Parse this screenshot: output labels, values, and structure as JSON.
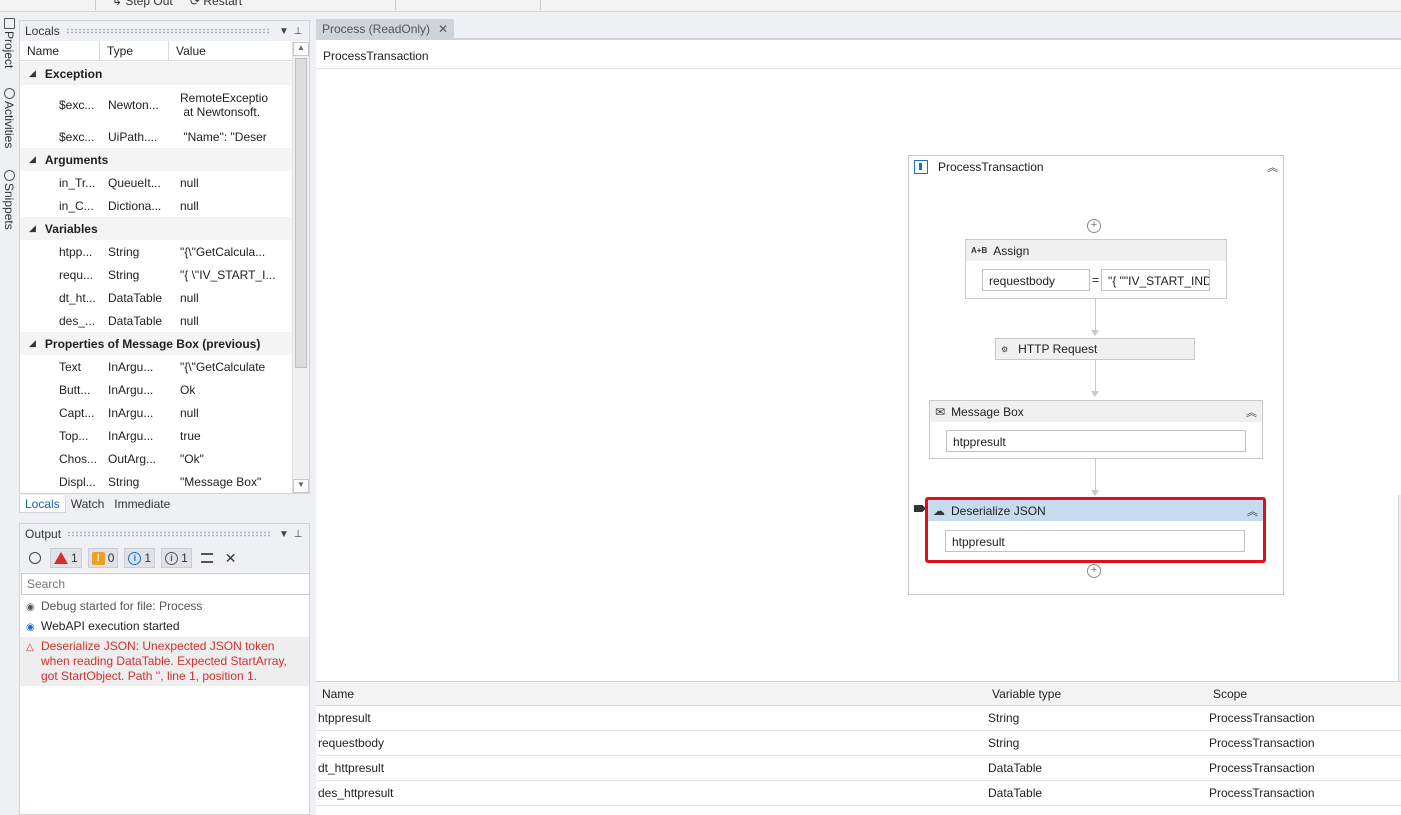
{
  "toolbar": {
    "step_out_label": "Step Out",
    "restart_label": "Restart"
  },
  "side_tabs": [
    "Project",
    "Activities",
    "Snippets"
  ],
  "locals": {
    "title": "Locals",
    "columns": [
      "Name",
      "Type",
      "Value"
    ],
    "groups": {
      "exception": "Exception",
      "arguments": "Arguments",
      "variables": "Variables",
      "properties": "Properties of Message Box (previous)"
    },
    "exception_rows": [
      {
        "name": "$exc...",
        "type": "Newton...",
        "value_line1": "RemoteExceptio",
        "value_line2": " at Newtonsoft."
      },
      {
        "name": "$exc...",
        "type": "UiPath....",
        "value": " \"Name\": \"Deser"
      }
    ],
    "argument_rows": [
      {
        "name": "in_Tr...",
        "type": "QueueIt...",
        "value": "null"
      },
      {
        "name": "in_C...",
        "type": "Dictiona...",
        "value": "null"
      }
    ],
    "variable_rows": [
      {
        "name": "htpp...",
        "type": "String",
        "value": "\"{\\\"GetCalcula..."
      },
      {
        "name": "requ...",
        "type": "String",
        "value": "\"{ \\\"IV_START_I..."
      },
      {
        "name": "dt_ht...",
        "type": "DataTable",
        "value": "null"
      },
      {
        "name": "des_...",
        "type": "DataTable",
        "value": "null"
      }
    ],
    "property_rows": [
      {
        "name": "Text",
        "type": "InArgu...",
        "value": "\"{\\\"GetCalculate"
      },
      {
        "name": "Butt...",
        "type": "InArgu...",
        "value": "Ok"
      },
      {
        "name": "Capt...",
        "type": "InArgu...",
        "value": "null"
      },
      {
        "name": "Top...",
        "type": "InArgu...",
        "value": "true"
      },
      {
        "name": "Chos...",
        "type": "OutArg...",
        "value": "\"Ok\""
      },
      {
        "name": "Displ...",
        "type": "String",
        "value": "\"Message Box\""
      }
    ]
  },
  "bottom_tabs": [
    "Locals",
    "Watch",
    "Immediate"
  ],
  "output": {
    "title": "Output",
    "error_count": "1",
    "warning_count": "0",
    "info_count": "1",
    "trace_count": "1",
    "search_placeholder": "Search",
    "lines": [
      {
        "kind": "trace",
        "text": "Debug started for file: Process"
      },
      {
        "kind": "info",
        "text": "WebAPI execution started"
      },
      {
        "kind": "error",
        "text": "Deserialize JSON: Unexpected JSON token when reading DataTable. Expected StartArray, got StartObject. Path '', line 1, position 1."
      }
    ]
  },
  "designer": {
    "tab_label": "Process (ReadOnly)",
    "breadcrumb": "ProcessTransaction",
    "sequence_title": "ProcessTransaction",
    "assign": {
      "title": "Assign",
      "icon_text": "A+B",
      "to": "requestbody",
      "equals": "=",
      "value": "\"{ \"\"IV_START_INDI"
    },
    "http_request": {
      "title": "HTTP Request"
    },
    "message_box": {
      "title": "Message Box",
      "text": "htppresult"
    },
    "deserialize_json": {
      "title": "Deserialize JSON",
      "input": "htppresult"
    }
  },
  "variables_panel": {
    "columns": [
      "Name",
      "Variable type",
      "Scope"
    ],
    "rows": [
      {
        "name": "htppresult",
        "type": "String",
        "scope": "ProcessTransaction"
      },
      {
        "name": "requestbody",
        "type": "String",
        "scope": "ProcessTransaction"
      },
      {
        "name": "dt_httpresult",
        "type": "DataTable",
        "scope": "ProcessTransaction"
      },
      {
        "name": "des_httpresult",
        "type": "DataTable",
        "scope": "ProcessTransaction"
      }
    ]
  },
  "colors": {
    "selection_border": "#e0101a",
    "selected_header": "#c5dcf0",
    "error_text": "#d32f2f",
    "accent": "#1e6fd0"
  }
}
